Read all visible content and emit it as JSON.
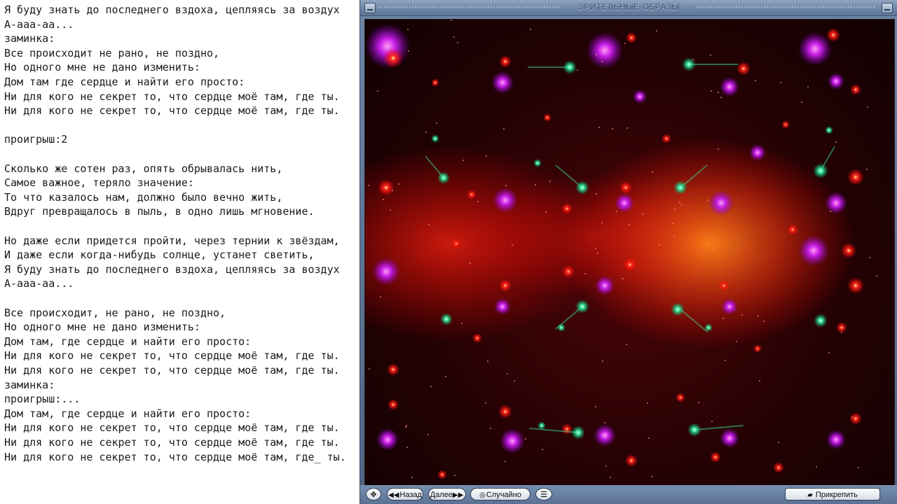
{
  "editor": {
    "lines": [
      "Я буду знать до последнего вздоха, цепляясь за воздух",
      "А-ааа-аа...",
      "заминка:",
      "Все происходит не рано, не поздно,",
      "Но одного мне не дано изменить:",
      "Дом там где сердце и найти его просто:",
      "Ни для кого не секрет то, что сердце моё там, где ты.",
      "Ни для кого не секрет то, что сердце моё там, где ты.",
      "",
      "проигрыш:2",
      "",
      "Сколько же сотен раз, опять обрывалась нить,",
      "Самое важное, теряло значение:",
      "То что казалось нам, должно было вечно жить,",
      "Вдруг превращалось в пыль, в одно лишь мгновение.",
      "",
      "Но даже если придется пройти, через тернии к звёздам,",
      "И даже если когда-нибудь солнце, устанет светить,",
      "Я буду знать до последнего вздоха, цепляясь за воздух",
      "А-ааа-аа...",
      "",
      "Все происходит, не рано, не поздно,",
      "Но одного мне не дано изменить:",
      "Дом там, где сердце и найти его просто:",
      "Ни для кого не секрет то, что сердце моё там, где ты.",
      "Ни для кого не секрет то, что сердце моё там, где ты.",
      "заминка:",
      "проигрыш:...",
      "Дом там, где сердце и найти его просто:",
      "Ни для кого не секрет то, что сердце моё там, где ты.",
      "Ни для кого не секрет то, что сердце моё там, где ты.",
      "Ни для кого не секрет то, что сердце моё там, где_ ты."
    ]
  },
  "window": {
    "title": "ЗРИТЕЛЬНЫЕ ОБРАЗЫ"
  },
  "controls": {
    "back_label": "Назад",
    "next_label": "Далее",
    "random_label": "Случайно",
    "pin_label": "Прикрепить"
  },
  "colors": {
    "viz_background": "#250204",
    "glow_red": "#ff1a1a",
    "glow_magenta": "#c81ee8",
    "glow_green": "#3cf2a0",
    "glow_orange": "#ff7a10",
    "chrome_blue": "#6e86a6"
  },
  "icons": {
    "fullscreen": "move-arrows-icon",
    "back": "double-left-arrow-icon",
    "next": "double-right-arrow-icon",
    "random": "shuffle-circle-icon",
    "menu": "list-menu-icon",
    "pin": "pin-icon",
    "minimize": "minimize-icon"
  }
}
